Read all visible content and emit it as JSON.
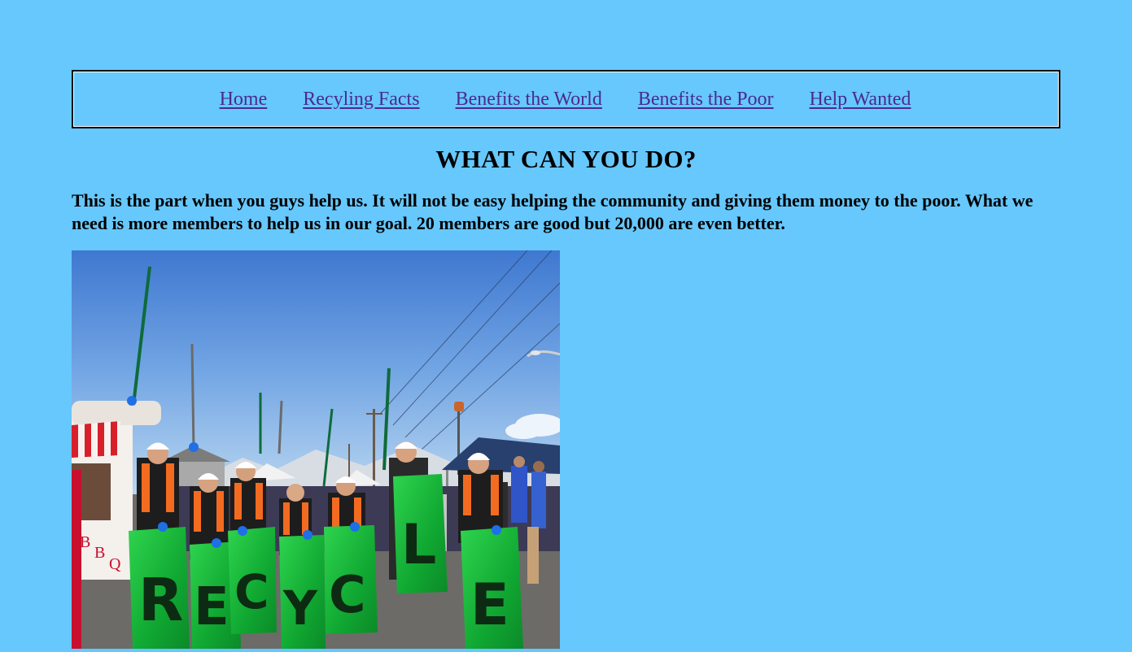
{
  "nav": {
    "items": [
      {
        "label": "Home"
      },
      {
        "label": "Recyling Facts"
      },
      {
        "label": "Benefits the World"
      },
      {
        "label": "Benefits the Poor"
      },
      {
        "label": "Help Wanted"
      }
    ],
    "link_color": "#4a2b8e"
  },
  "page": {
    "heading": "WHAT CAN YOU DO?",
    "intro": "This is the part when you guys help us. It will not be easy helping the community and giving them money to the poor. What we need is more members to help us in our goal. 20 members are good but 20,000 are even better.",
    "background_color": "#66c8fd"
  },
  "photo": {
    "subject": "volunteers-holding-recycle-bags",
    "bag_letters": [
      "R",
      "E",
      "C",
      "Y",
      "C",
      "L",
      "E"
    ],
    "sign_letters": "BBQ"
  }
}
